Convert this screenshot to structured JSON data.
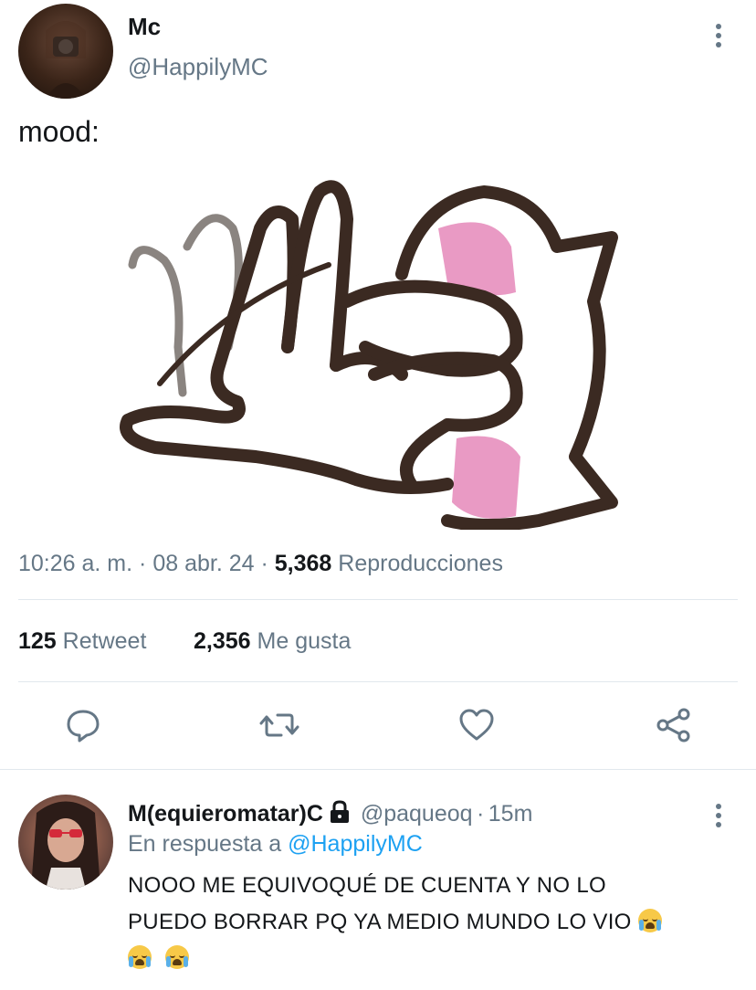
{
  "tweet": {
    "author_name": "Mc",
    "author_handle": "@HappilyMC",
    "text": "mood:",
    "time": "10:26 a. m.",
    "date": "08 abr. 24",
    "views_count": "5,368",
    "views_label": "Reproducciones",
    "separator": "·",
    "retweets_count": "125",
    "retweets_label": "Retweet",
    "likes_count": "2,356",
    "likes_label": "Me gusta"
  },
  "actions": {
    "reply_icon": "reply-icon",
    "retweet_icon": "retweet-icon",
    "like_icon": "heart-icon",
    "share_icon": "share-icon"
  },
  "reply": {
    "author_name": "M(equieromatar)C",
    "lock_icon": "lock-icon",
    "author_handle": "@paqueoq",
    "separator": "·",
    "time": "15m",
    "in_reply_prefix": "En respuesta a",
    "in_reply_handle": "@HappilyMC",
    "text_line1": "NOOO ME EQUIVOQUÉ DE CUENTA Y NO LO",
    "text_line2": "PUEDO BORRAR PQ YA MEDIO MUNDO LO VIO"
  },
  "colors": {
    "text": "#14171a",
    "secondary": "#657786",
    "link": "#1da1f2",
    "divider": "#e1e8ed",
    "sticker_outline": "#3b2a22",
    "sticker_pink": "#e99ac4"
  }
}
